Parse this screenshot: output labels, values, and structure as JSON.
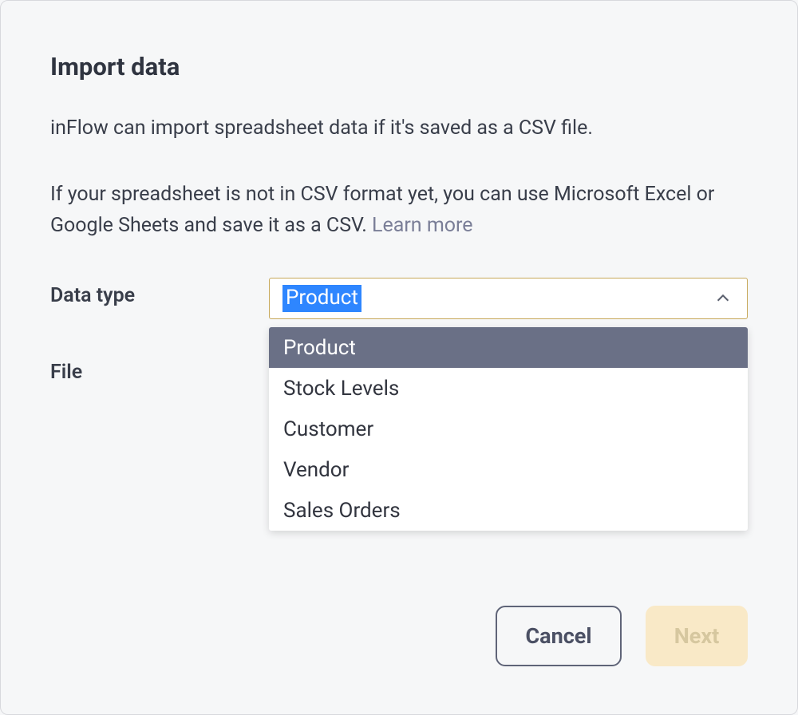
{
  "dialog": {
    "title": "Import data",
    "description_line1": "inFlow can import spreadsheet data if it's saved as a CSV file.",
    "description_line2_prefix": "If your spreadsheet is not in CSV format yet, you can use Microsoft Excel or Google Sheets and save it as a CSV. ",
    "learn_more": "Learn more"
  },
  "form": {
    "data_type_label": "Data type",
    "file_label": "File",
    "selected_value": "Product",
    "options": [
      "Product",
      "Stock Levels",
      "Customer",
      "Vendor",
      "Sales Orders"
    ]
  },
  "buttons": {
    "cancel": "Cancel",
    "next": "Next"
  }
}
